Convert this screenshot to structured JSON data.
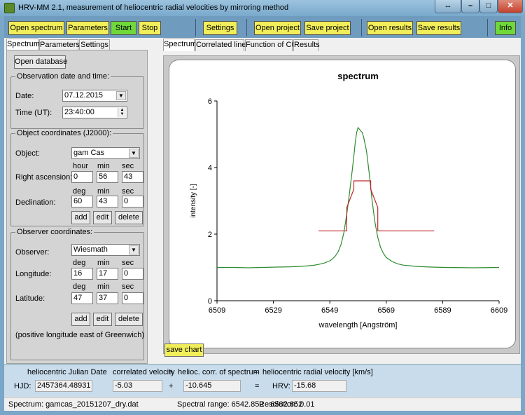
{
  "window": {
    "title": "HRV-MM 2.1,   measurement of heliocentric radial velocities by mirroring method"
  },
  "toolbar": {
    "open_spectrum": "Open spectrum",
    "parameters": "Parameters",
    "start": "Start",
    "stop": "Stop",
    "settings": "Settings",
    "open_project": "Open project",
    "save_project": "Save project",
    "open_results": "Open results",
    "save_results": "Save results",
    "info": "Info"
  },
  "left_tabs": [
    "Spectrum",
    "Parameters",
    "Settings"
  ],
  "right_tabs": [
    "Spectrum",
    "Correlated lines",
    "Function of CC",
    "Results"
  ],
  "open_database": "Open database",
  "observation": {
    "title": "Observation date and time:",
    "date_label": "Date:",
    "date_value": "07.12.2015",
    "time_label": "Time (UT):",
    "time_value": "23:40:00"
  },
  "object": {
    "title": "Object coordinates (J2000):",
    "object_label": "Object:",
    "object_value": "gam Cas",
    "ra_label": "Right ascension:",
    "ra_headers": [
      "hour",
      "min",
      "sec"
    ],
    "ra_values": [
      "0",
      "56",
      "43"
    ],
    "dec_label": "Declination:",
    "dec_headers": [
      "deg",
      "min",
      "sec"
    ],
    "dec_values": [
      "60",
      "43",
      "0"
    ],
    "add": "add",
    "edit": "edit",
    "delete": "delete"
  },
  "observer": {
    "title": "Observer coordinates:",
    "observer_label": "Observer:",
    "observer_value": "Wiesmath",
    "lon_label": "Longitude:",
    "lon_headers": [
      "deg",
      "min",
      "sec"
    ],
    "lon_values": [
      "16",
      "17",
      "0"
    ],
    "lat_label": "Latitude:",
    "lat_headers": [
      "deg",
      "min",
      "sec"
    ],
    "lat_values": [
      "47",
      "37",
      "0"
    ],
    "add": "add",
    "edit": "edit",
    "delete": "delete",
    "note": "(positive longitude east of Greenwich)"
  },
  "save_chart": "save chart",
  "results": {
    "hjd_header": "heliocentric Julian Date",
    "hjd_label": "HJD:",
    "hjd_value": "2457364.48931",
    "corr_header": "correlated velocity",
    "plus1": "+",
    "helioc_header": "helioc. corr. of spectrum",
    "eq1": "=",
    "hrv_header": "heliocentric radial velocity [km/s]",
    "corr_value": "-5.03",
    "plus2": "+",
    "helioc_value": "-10.645",
    "eq2": "=",
    "hrv_label": "HRV:",
    "hrv_value": "-15.68"
  },
  "status": {
    "spectrum": "Spectrum:   gamcas_20151207_dry.dat",
    "range": "Spectral range:  6542.852 - 6582.852",
    "resolution": "Resolution:  0.01"
  },
  "chart_data": {
    "type": "line",
    "title": "spectrum",
    "xlabel": "wavelength [Angström]",
    "ylabel": "intensity [-]",
    "xlim": [
      6509,
      6609
    ],
    "ylim": [
      0,
      6
    ],
    "xticks": [
      6509,
      6529,
      6549,
      6569,
      6589,
      6609
    ],
    "yticks": [
      0,
      2,
      4,
      6
    ],
    "series": [
      {
        "color": "#2e8b2e",
        "x": [
          6509,
          6515,
          6520,
          6525,
          6530,
          6535,
          6540,
          6543,
          6545,
          6547,
          6549,
          6550,
          6551,
          6552,
          6553,
          6554,
          6555,
          6556,
          6557,
          6557.5,
          6558,
          6558.5,
          6559,
          6559.5,
          6560,
          6560.5,
          6561,
          6562,
          6563,
          6564,
          6565,
          6566,
          6567,
          6568,
          6569,
          6571,
          6573,
          6575,
          6580,
          6585,
          6590,
          6600,
          6609
        ],
        "y": [
          1.0,
          1.0,
          0.99,
          1.0,
          1.01,
          1.02,
          1.04,
          1.06,
          1.09,
          1.13,
          1.2,
          1.26,
          1.35,
          1.48,
          1.7,
          2.05,
          2.6,
          3.25,
          3.95,
          4.35,
          4.75,
          5.05,
          5.2,
          5.15,
          5.1,
          5.05,
          4.9,
          4.5,
          3.8,
          3.0,
          2.35,
          1.9,
          1.6,
          1.42,
          1.3,
          1.18,
          1.11,
          1.07,
          1.03,
          1.01,
          1.0,
          0.99,
          1.0
        ]
      },
      {
        "color": "#c0282d",
        "x": [
          6545,
          6555,
          6555,
          6557.5,
          6557.5,
          6563.5,
          6563.5,
          6566,
          6566,
          6586
        ],
        "y": [
          2.1,
          2.1,
          2.8,
          3.35,
          3.6,
          3.6,
          3.35,
          2.8,
          2.1,
          2.1
        ]
      }
    ]
  }
}
